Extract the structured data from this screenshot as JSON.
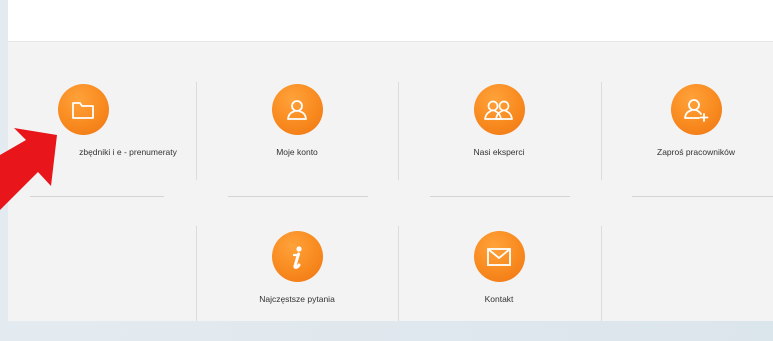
{
  "tiles": [
    {
      "label": "zbędniki i e - prenumeraty",
      "icon": "folder-icon"
    },
    {
      "label": "Moje konto",
      "icon": "user-icon"
    },
    {
      "label": "Nasi eksperci",
      "icon": "users-icon"
    },
    {
      "label": "Zaproś pracowników",
      "icon": "add-user-icon"
    },
    {
      "label": "Najczęstsze pytania",
      "icon": "info-icon"
    },
    {
      "label": "Kontakt",
      "icon": "envelope-icon"
    }
  ],
  "colors": {
    "accent": "#f88a1f",
    "arrow": "#e8151b"
  }
}
